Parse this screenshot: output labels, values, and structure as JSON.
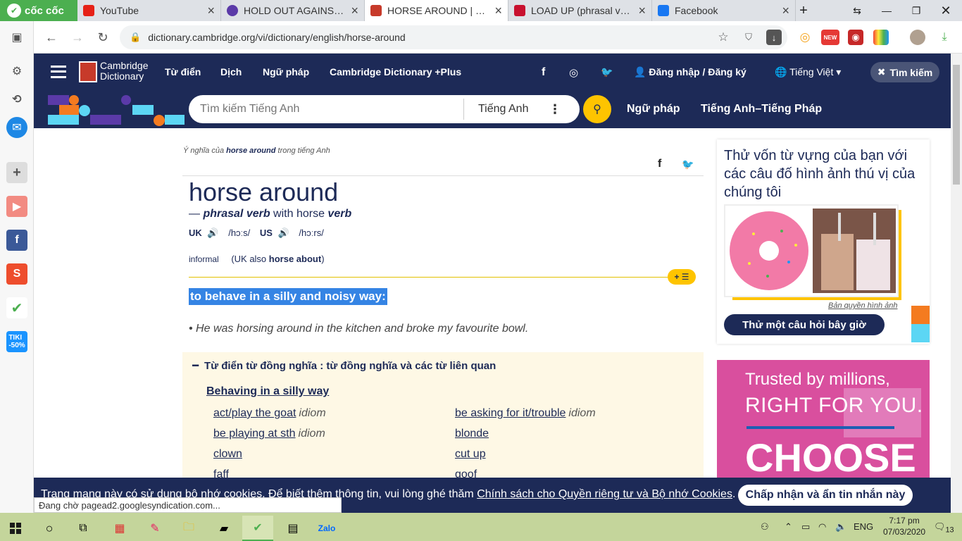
{
  "browser": {
    "brand": "cốc cốc",
    "tabs": [
      {
        "title": "YouTube",
        "color": "#e62117"
      },
      {
        "title": "HOLD OUT AGAINST - Định nghĩa",
        "color": "#5b3aa8"
      },
      {
        "title": "HORSE AROUND | Định nghĩa",
        "color": "#c73a2a"
      },
      {
        "title": "LOAD UP (phrasal verb) definit",
        "color": "#c8102e"
      },
      {
        "title": "Facebook",
        "color": "#1877f2"
      }
    ],
    "url": "dictionary.cambridge.org/vi/dictionary/english/horse-around",
    "new_badge": "NEW"
  },
  "site": {
    "logo_line1": "Cambridge",
    "logo_line2": "Dictionary",
    "nav": [
      "Từ điển",
      "Dịch",
      "Ngữ pháp",
      "Cambridge Dictionary +Plus"
    ],
    "login": "Đăng nhập / Đăng ký",
    "language": "Tiếng Việt",
    "search_toggle": "Tìm kiếm",
    "search_placeholder": "Tìm kiếm Tiếng Anh",
    "search_lang": "Tiếng Anh",
    "quick_links": [
      "Ngữ pháp",
      "Tiếng Anh–Tiếng Pháp"
    ]
  },
  "entry": {
    "crumb_pre": "Ý nghĩa của ",
    "crumb_word": "horse around",
    "crumb_post": " trong tiếng Anh",
    "headword": "horse around",
    "dash": "— ",
    "pos": "phrasal verb",
    "with_text": " with horse ",
    "verb": "verb",
    "uk": "UK",
    "uk_ipa": "/hɔːs/",
    "us": "US",
    "us_ipa": "/hɔːrs/",
    "register": "informal",
    "also_pre": "(UK also ",
    "also_word": "horse about",
    "also_post": ")",
    "definition": "to behave in a silly and noisy way:",
    "example": "• He was horsing around in the kitchen and broke my favourite bowl."
  },
  "thesaurus": {
    "title": "Từ điển từ đồng nghĩa : từ đồng nghĩa và các từ liên quan",
    "subtitle": "Behaving in a silly way",
    "left": [
      {
        "word": "act/play the goat",
        "tag": "idiom"
      },
      {
        "word": "be playing at sth",
        "tag": "idiom"
      },
      {
        "word": "clown",
        "tag": ""
      },
      {
        "word": "faff",
        "tag": ""
      }
    ],
    "right": [
      {
        "word": "be asking for it/trouble",
        "tag": "idiom"
      },
      {
        "word": "blonde",
        "tag": ""
      },
      {
        "word": "cut up",
        "tag": ""
      },
      {
        "word": "goof",
        "tag": ""
      }
    ]
  },
  "quiz": {
    "title": "Thử vốn từ vựng của bạn với các câu đố hình ảnh thú vị của chúng tôi",
    "credit": "Bản quyền hình ảnh",
    "button": "Thử một câu hỏi bây giờ"
  },
  "ad": {
    "line1": "Trusted by millions,",
    "line2": "RIGHT FOR YOU.",
    "line3": "CHOOSE"
  },
  "cookie": {
    "text": "Trang mạng này có sử dụng bộ nhớ cookies. Để biết thêm thông tin, vui lòng ghé thăm ",
    "link": "Chính sách cho Quyền riêng tư và Bộ nhớ Cookies",
    "dot": ".",
    "button": "Chấp nhận và ẩn tin nhắn này"
  },
  "status": "Đang chờ pagead2.googlesyndication.com...",
  "taskbar": {
    "lang": "ENG",
    "time": "7:17 pm",
    "date": "07/03/2020",
    "notif": "13"
  },
  "colors": {
    "brand_navy": "#1d2a57",
    "accent_yellow": "#fec400",
    "highlight": "#3584e4"
  }
}
